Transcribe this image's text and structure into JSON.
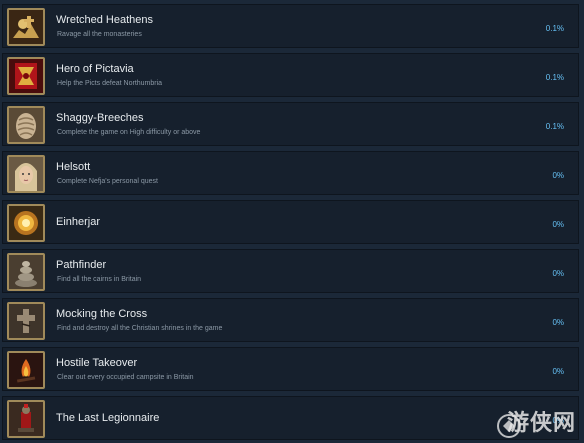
{
  "achievements": [
    {
      "title": "Wretched Heathens",
      "description": "Ravage all the monasteries",
      "percent": "0.1%",
      "icon": "gold-treasure-icon"
    },
    {
      "title": "Hero of Pictavia",
      "description": "Help the Picts defeat Northumbria",
      "percent": "0.1%",
      "icon": "red-banner-icon"
    },
    {
      "title": "Shaggy-Breeches",
      "description": "Complete the game on High difficulty or above",
      "percent": "0.1%",
      "icon": "fur-breeches-icon"
    },
    {
      "title": "Helsott",
      "description": "Complete Nefja's personal quest",
      "percent": "0%",
      "icon": "woman-portrait-icon"
    },
    {
      "title": "Einherjar",
      "description": "",
      "percent": "0%",
      "icon": "golden-burst-icon"
    },
    {
      "title": "Pathfinder",
      "description": "Find all the cairns in Britain",
      "percent": "0%",
      "icon": "stone-cairn-icon"
    },
    {
      "title": "Mocking the Cross",
      "description": "Find and destroy all the Christian shrines in the game",
      "percent": "0%",
      "icon": "broken-cross-icon"
    },
    {
      "title": "Hostile Takeover",
      "description": "Clear out every occupied campsite in Britain",
      "percent": "0%",
      "icon": "campfire-icon"
    },
    {
      "title": "The Last Legionnaire",
      "description": "",
      "percent": "0%",
      "icon": "legionnaire-icon"
    }
  ],
  "watermark": {
    "text": "游侠网"
  },
  "colors": {
    "background": "#1b2838",
    "row": "#16202d",
    "percent": "#66c0f4",
    "title": "#e8ecef",
    "description": "#8b98a5"
  }
}
